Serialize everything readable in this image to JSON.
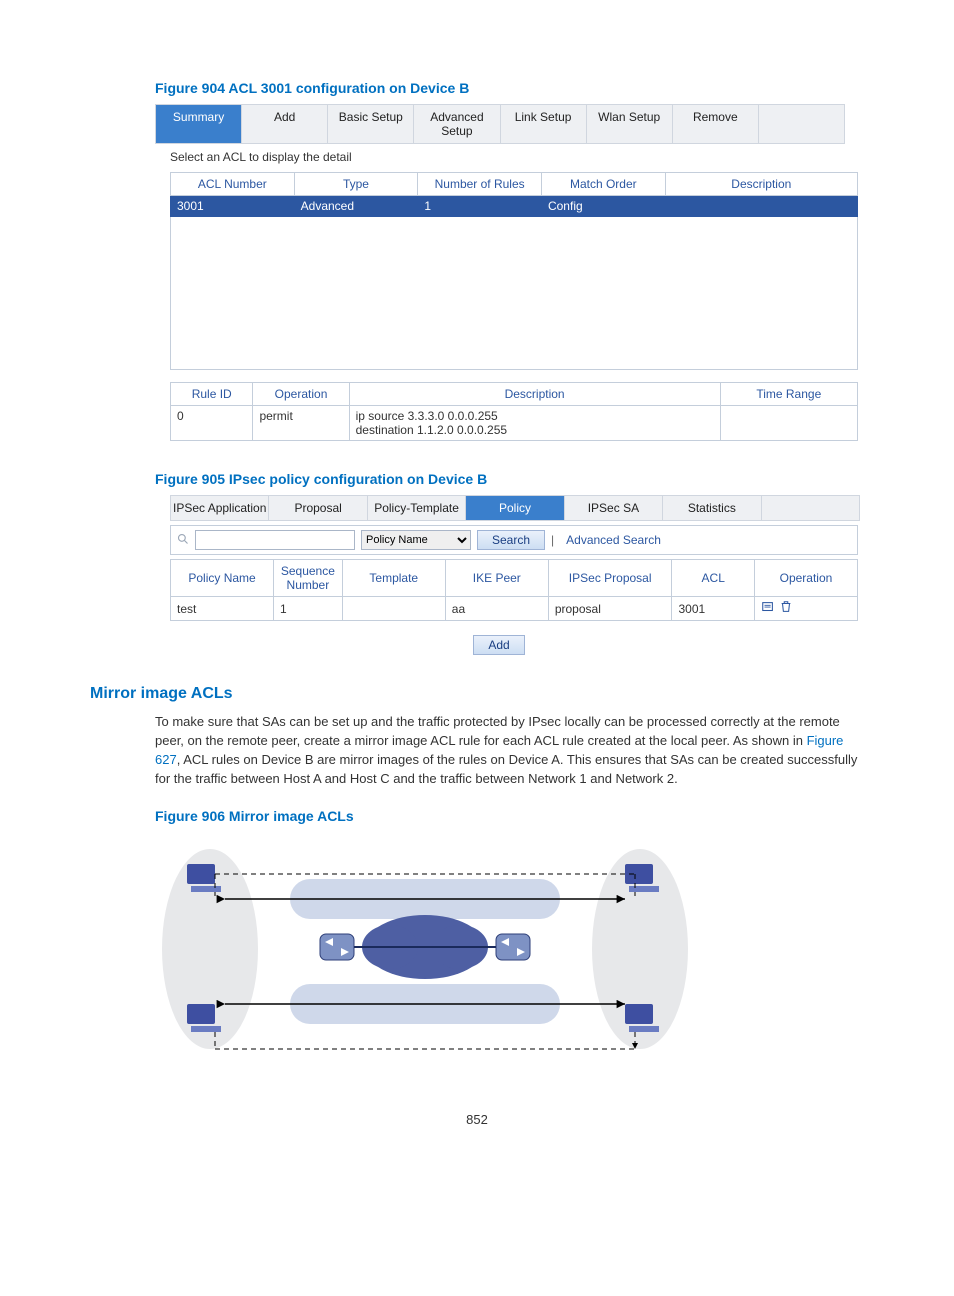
{
  "figure904": {
    "caption": "Figure 904 ACL 3001 configuration on Device B",
    "tabs": [
      "Summary",
      "Add",
      "Basic Setup",
      "Advanced Setup",
      "Link Setup",
      "Wlan Setup",
      "Remove",
      ""
    ],
    "active_tab_index": 0,
    "hint": "Select an ACL to display the detail",
    "acl_headers": [
      "ACL Number",
      "Type",
      "Number of Rules",
      "Match Order",
      "Description"
    ],
    "acl_row": {
      "number": "3001",
      "type": "Advanced",
      "rules": "1",
      "order": "Config",
      "desc": ""
    },
    "rule_headers": [
      "Rule ID",
      "Operation",
      "Description",
      "Time Range"
    ],
    "rule_row": {
      "id": "0",
      "op": "permit",
      "desc_line1": "ip source 3.3.3.0 0.0.0.255",
      "desc_line2": "destination 1.1.2.0 0.0.0.255",
      "time": ""
    }
  },
  "figure905": {
    "caption": "Figure 905 IPsec policy configuration on Device B",
    "tabs": [
      "IPSec Application",
      "Proposal",
      "Policy-Template",
      "Policy",
      "IPSec SA",
      "Statistics",
      ""
    ],
    "active_tab_index": 3,
    "search": {
      "field_value": "",
      "dropdown_value": "Policy Name",
      "button": "Search",
      "advanced": "Advanced Search"
    },
    "policy_headers": [
      "Policy Name",
      "Sequence Number",
      "Template",
      "IKE Peer",
      "IPSec Proposal",
      "ACL",
      "Operation"
    ],
    "policy_row": {
      "name": "test",
      "seq": "1",
      "template": "",
      "ike": "aa",
      "proposal": "proposal",
      "acl": "3001"
    },
    "op_icons": [
      "edit-icon",
      "delete-icon"
    ],
    "add_button": "Add"
  },
  "section": {
    "title": "Mirror image ACLs",
    "para_prefix": "To make sure that SAs can be set up and the traffic protected by IPsec locally can be processed correctly at the remote peer, on the remote peer, create a mirror image ACL rule for each ACL rule created at the local peer. As shown in ",
    "para_link": "Figure 627",
    "para_suffix": ", ACL rules on Device B are mirror images of the rules on Device A. This ensures that SAs can be created successfully for the traffic between Host A and Host C and the traffic between Network 1 and Network 2."
  },
  "figure906": {
    "caption": "Figure 906 Mirror image ACLs"
  },
  "page_number": "852"
}
